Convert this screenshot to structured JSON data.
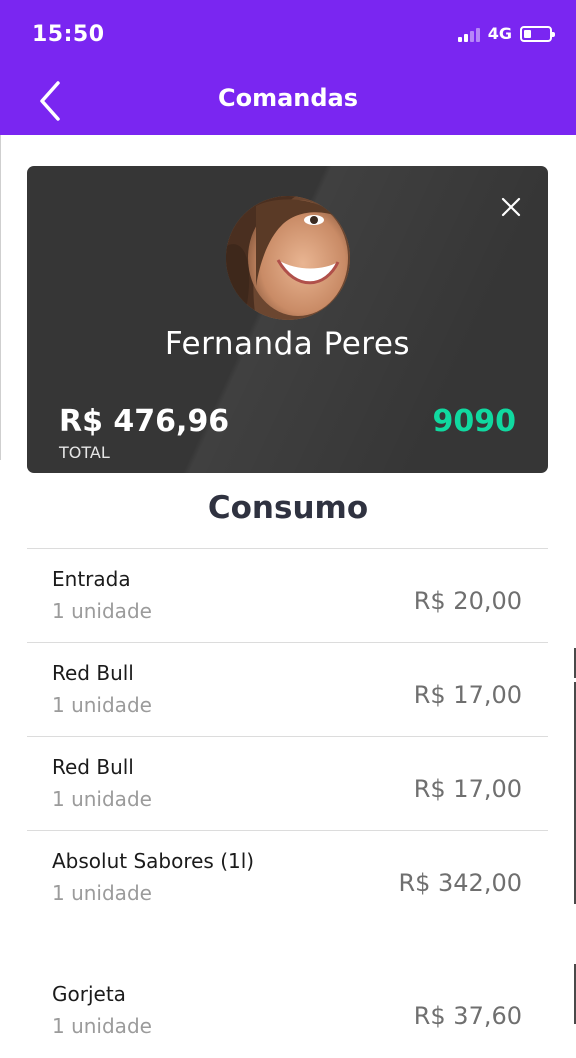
{
  "status_bar": {
    "time": "15:50",
    "network": "4G"
  },
  "nav": {
    "title": "Comandas"
  },
  "card": {
    "name": "Fernanda Peres",
    "total_value": "R$ 476,96",
    "total_label": "TOTAL",
    "code": "9090"
  },
  "section": {
    "title": "Consumo"
  },
  "items": [
    {
      "name": "Entrada",
      "qty": "1 unidade",
      "price": "R$ 20,00"
    },
    {
      "name": "Red Bull",
      "qty": "1 unidade",
      "price": "R$ 17,00"
    },
    {
      "name": "Red Bull",
      "qty": "1 unidade",
      "price": "R$ 17,00"
    },
    {
      "name": "Absolut Sabores (1l)",
      "qty": "1 unidade",
      "price": "R$ 342,00"
    },
    {
      "name": "Gorjeta",
      "qty": "1 unidade",
      "price": "R$ 37,60"
    }
  ],
  "colors": {
    "header": "#7a26f1",
    "card_bg": "#363636",
    "code_accent": "#10d9a0"
  }
}
